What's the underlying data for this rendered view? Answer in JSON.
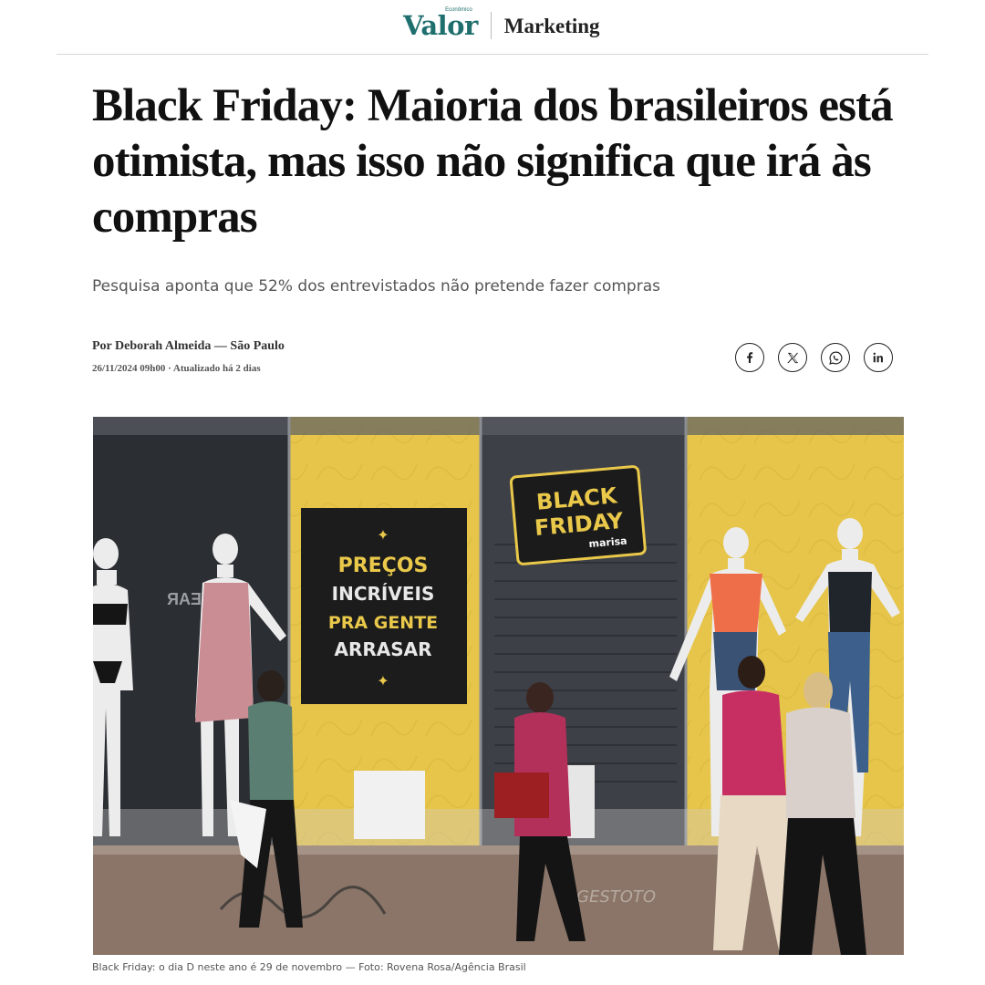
{
  "header": {
    "logo": "Valor",
    "logo_tag": "Econômico",
    "section": "Marketing"
  },
  "article": {
    "headline": "Black Friday: Maioria dos brasileiros está otimista, mas isso não significa que irá às compras",
    "subtitle": "Pesquisa aponta que 52% dos entrevistados não pretende fazer compras",
    "byline": "Por Deborah Almeida — São Paulo",
    "dateline": "26/11/2024 09h00 · Atualizado há 2 dias",
    "caption": "Black Friday: o dia D neste ano é 29 de novembro — Foto: Rovena Rosa/Agência Brasil"
  },
  "share": [
    {
      "icon": "facebook-icon"
    },
    {
      "icon": "x-icon"
    },
    {
      "icon": "whatsapp-icon"
    },
    {
      "icon": "linkedin-icon"
    }
  ],
  "photo": {
    "sign_lines": [
      "PREÇOS",
      "INCRÍVEIS",
      "PRA GENTE",
      "ARRASAR"
    ],
    "badge_line1": "BLACK",
    "badge_line2": "FRIDAY",
    "badge_brand": "marisa",
    "store_text": "WEAR",
    "graffiti": "GESTOTO"
  },
  "colors": {
    "brand": "#1f6f6e",
    "sign_yellow": "#e9c84a",
    "sign_black": "#1c1c1c"
  }
}
